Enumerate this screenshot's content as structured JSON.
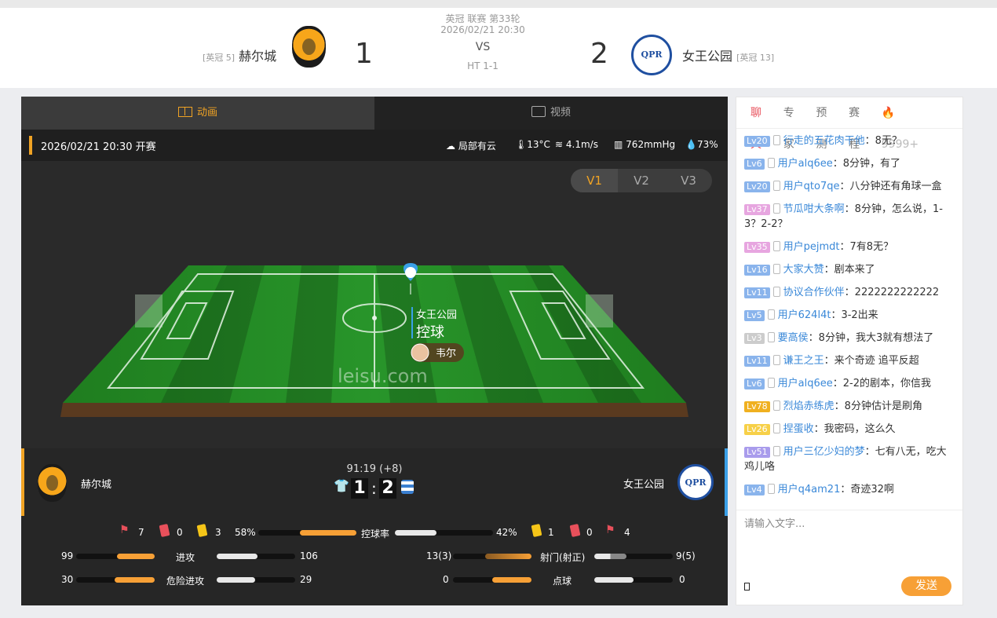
{
  "match": {
    "league_round": "英冠 联赛 第33轮",
    "datetime": "2026/02/21 20:30",
    "vs": "VS",
    "halftime": "HT 1-1",
    "home": {
      "name": "赫尔城",
      "rank": "[英冠 5]",
      "score": "1"
    },
    "away": {
      "name": "女王公园",
      "rank": "[英冠 13]",
      "score": "2"
    }
  },
  "tabs": {
    "animation": "动画",
    "video": "视频"
  },
  "info": {
    "kickoff": "2026/02/21 20:30 开赛",
    "weather": "局部有云",
    "temp": "13°C",
    "wind": "4.1m/s",
    "pressure": "762mmHg",
    "humidity": "73%"
  },
  "versions": [
    "V1",
    "V2",
    "V3"
  ],
  "pitch": {
    "team": "女王公园",
    "action": "控球",
    "player": "韦尔",
    "watermark": "leisu.com"
  },
  "live": {
    "time": "91:19 (+8)",
    "home_score": "1",
    "away_score": "2",
    "colon": ":"
  },
  "stats": {
    "home_corners": "7",
    "home_red": "0",
    "home_yellow": "3",
    "away_yellow": "1",
    "away_red": "0",
    "away_corners": "4",
    "possession": {
      "label": "控球率",
      "home": "58%",
      "away": "42%",
      "home_v": 58,
      "away_v": 42
    },
    "attack": {
      "label": "进攻",
      "home": "99",
      "away": "106",
      "home_v": 99,
      "away_v": 106
    },
    "danger": {
      "label": "危险进攻",
      "home": "30",
      "away": "29",
      "home_v": 30,
      "away_v": 29
    },
    "shots": {
      "label": "射门(射正)",
      "home": "13(3)",
      "away": "9(5)",
      "home_v": 13,
      "away_v": 9
    },
    "penalty": {
      "label": "点球",
      "home": "0",
      "away": "0",
      "home_v": 0,
      "away_v": 0
    }
  },
  "chat": {
    "tabs": [
      "聊天",
      "专家",
      "预测",
      "赛程"
    ],
    "hot": "9999+",
    "messages": [
      {
        "lv": "Lv20",
        "c": "#8ab4ec",
        "user": "行走的五花肉干他",
        "text": "8无？"
      },
      {
        "lv": "Lv6",
        "c": "#8ab4ec",
        "user": "用户alq6ee",
        "text": "8分钟，有了"
      },
      {
        "lv": "Lv20",
        "c": "#8ab4ec",
        "user": "用户qto7qe",
        "text": "八分钟还有角球一盒"
      },
      {
        "lv": "Lv37",
        "c": "#e7a6e0",
        "user": "节瓜咁大条啊",
        "text": "8分钟，怎么说，1-3？2-2？"
      },
      {
        "lv": "Lv35",
        "c": "#e7a6e0",
        "user": "用户pejmdt",
        "text": "7有8无？"
      },
      {
        "lv": "Lv16",
        "c": "#8ab4ec",
        "user": "大家大赞",
        "text": "剧本来了"
      },
      {
        "lv": "Lv11",
        "c": "#8ab4ec",
        "user": "协议合作伙伴",
        "text": "2222222222222"
      },
      {
        "lv": "Lv5",
        "c": "#8ab4ec",
        "user": "用户624l4t",
        "text": "3-2出来"
      },
      {
        "lv": "Lv3",
        "c": "#cccccc",
        "user": "要高侯",
        "text": "8分钟，我大3就有想法了"
      },
      {
        "lv": "Lv11",
        "c": "#8ab4ec",
        "user": "谦王之王",
        "text": "来个奇迹 追平反超"
      },
      {
        "lv": "Lv6",
        "c": "#8ab4ec",
        "user": "用户alq6ee",
        "text": "2-2的剧本，你信我"
      },
      {
        "lv": "Lv78",
        "c": "#f0b020",
        "user": "烈焰赤练虎",
        "text": "8分钟估计是刷角"
      },
      {
        "lv": "Lv26",
        "c": "#f7d048",
        "user": "捏蛋收",
        "text": "我密码，这么久"
      },
      {
        "lv": "Lv51",
        "c": "#a99cec",
        "user": "用户三亿少妇的梦",
        "text": "七有八无，吃大鸡儿咯"
      },
      {
        "lv": "Lv4",
        "c": "#8ab4ec",
        "user": "用户q4am21",
        "text": "奇迹32啊"
      }
    ],
    "input_placeholder": "请输入文字...",
    "send": "发送"
  }
}
